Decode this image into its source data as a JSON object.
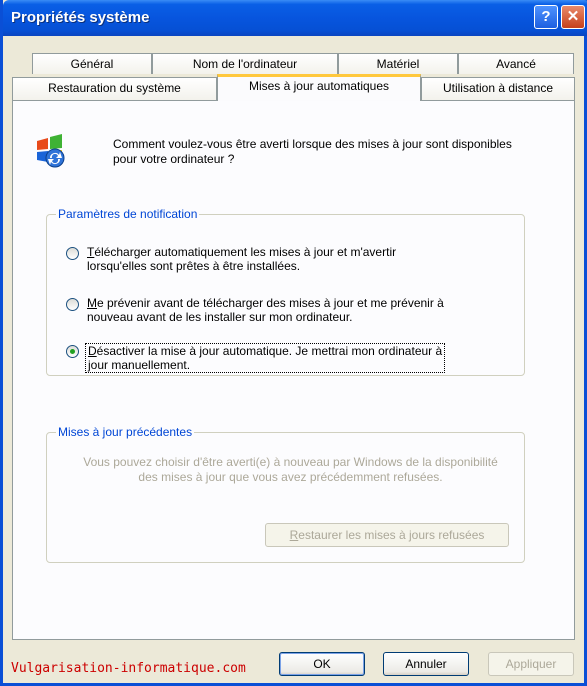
{
  "window": {
    "title": "Propriétés système",
    "help_glyph": "?",
    "close_glyph": "✕"
  },
  "tabs": {
    "row1": [
      "Général",
      "Nom de l'ordinateur",
      "Matériel",
      "Avancé"
    ],
    "row2": [
      "Restauration du système",
      "Mises à jour automatiques",
      "Utilisation à distance"
    ],
    "active": "Mises à jour automatiques"
  },
  "intro": {
    "icon": "windows-update-icon",
    "text": "Comment voulez-vous être averti lorsque des mises à jour sont disponibles pour votre ordinateur ?"
  },
  "notification": {
    "legend": "Paramètres de notification",
    "options": [
      {
        "mnemonic": "T",
        "rest": "élécharger automatiquement les mises à jour et m'avertir",
        "line2": "lorsqu'elles sont prêtes à être installées.",
        "selected": false
      },
      {
        "mnemonic": "M",
        "rest": "e prévenir avant de télécharger des mises à jour et me prévenir à",
        "line2": "nouveau avant de les installer sur mon ordinateur.",
        "selected": false
      },
      {
        "mnemonic": "D",
        "rest": "ésactiver la mise à jour automatique. Je mettrai mon ordinateur à",
        "line2": "jour manuellement.",
        "selected": true
      }
    ]
  },
  "previous": {
    "legend": "Mises à jour précédentes",
    "text": "Vous pouvez choisir d'être averti(e) à nouveau par Windows de la disponibilité des mises à jour que vous avez précédemment refusées.",
    "restore_mnemonic": "R",
    "restore_rest": "estaurer les mises à jours refusées"
  },
  "watermark": "Vulgarisation-informatique.com",
  "buttons": {
    "ok": "OK",
    "cancel": "Annuler",
    "apply": "Appliquer"
  }
}
